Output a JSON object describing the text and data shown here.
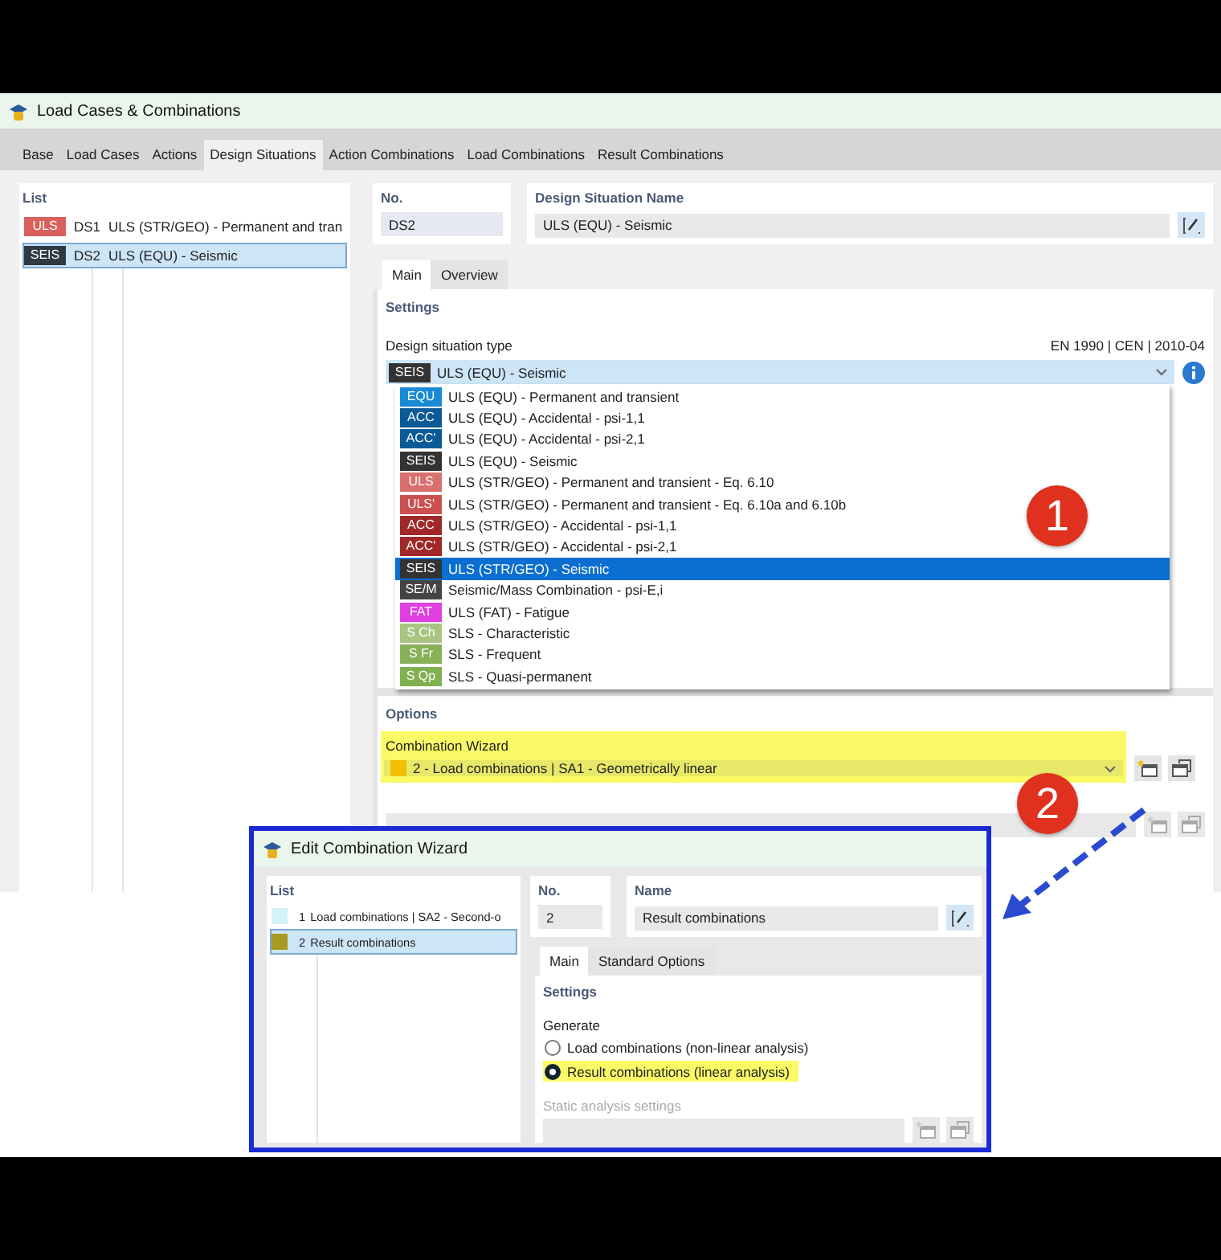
{
  "window": {
    "title": "Load Cases & Combinations"
  },
  "tabs": [
    {
      "label": "Base",
      "selected": false
    },
    {
      "label": "Load Cases",
      "selected": false
    },
    {
      "label": "Actions",
      "selected": false
    },
    {
      "label": "Design Situations",
      "selected": true
    },
    {
      "label": "Action Combinations",
      "selected": false
    },
    {
      "label": "Load Combinations",
      "selected": false
    },
    {
      "label": "Result Combinations",
      "selected": false
    }
  ],
  "list": {
    "header": "List",
    "items": [
      {
        "badge": "ULS",
        "color": "#d9605c",
        "number": "DS1",
        "name": "ULS (STR/GEO) - Permanent and tran",
        "selected": false
      },
      {
        "badge": "SEIS",
        "color": "#2f3a44",
        "number": "DS2",
        "name": "ULS (EQU) - Seismic",
        "selected": true
      }
    ]
  },
  "number": {
    "label": "No.",
    "value": "DS2"
  },
  "name": {
    "label": "Design Situation Name",
    "value": "ULS (EQU) - Seismic"
  },
  "subtabs": [
    {
      "label": "Main",
      "selected": true
    },
    {
      "label": "Overview",
      "selected": false
    }
  ],
  "settings": {
    "title": "Settings",
    "type_label": "Design situation type",
    "standard": "EN 1990 | CEN | 2010-04",
    "value": {
      "badge": "SEIS",
      "color": "#333333",
      "label": "ULS (EQU) - Seismic"
    },
    "options": [
      {
        "badge": "EQU",
        "color": "#1a8ad4",
        "label": "ULS (EQU) - Permanent and transient",
        "selected": false
      },
      {
        "badge": "ACC",
        "color": "#0b5a98",
        "label": "ULS (EQU) - Accidental - psi-1,1",
        "selected": false
      },
      {
        "badge": "ACC'",
        "color": "#0b5a98",
        "label": "ULS (EQU) - Accidental - psi-2,1",
        "selected": false
      },
      {
        "badge": "SEIS",
        "color": "#333333",
        "label": "ULS (EQU) - Seismic",
        "selected": false
      },
      {
        "badge": "ULS",
        "color": "#d97070",
        "label": "ULS (STR/GEO) - Permanent and transient - Eq. 6.10",
        "selected": false
      },
      {
        "badge": "ULS'",
        "color": "#cc5050",
        "label": "ULS (STR/GEO) - Permanent and transient - Eq. 6.10a and 6.10b",
        "selected": false
      },
      {
        "badge": "ACC",
        "color": "#a02828",
        "label": "ULS (STR/GEO) - Accidental - psi-1,1",
        "selected": false
      },
      {
        "badge": "ACC'",
        "color": "#a02828",
        "label": "ULS (STR/GEO) - Accidental - psi-2,1",
        "selected": false
      },
      {
        "badge": "SEIS",
        "color": "#333333",
        "label": "ULS (STR/GEO) - Seismic",
        "selected": true
      },
      {
        "badge": "SE/M",
        "color": "#444444",
        "label": "Seismic/Mass Combination - psi-E,i",
        "selected": false
      },
      {
        "badge": "FAT",
        "color": "#e040e0",
        "label": "ULS (FAT) - Fatigue",
        "selected": false
      },
      {
        "badge": "S Ch",
        "color": "#a8c480",
        "label": "SLS - Characteristic",
        "selected": false
      },
      {
        "badge": "S Fr",
        "color": "#88b058",
        "label": "SLS - Frequent",
        "selected": false
      },
      {
        "badge": "S Qp",
        "color": "#80b050",
        "label": "SLS - Quasi-permanent",
        "selected": false
      }
    ]
  },
  "options": {
    "title": "Options",
    "wizard": {
      "label": "Combination Wizard",
      "highlighted": true,
      "color": "#f0c000",
      "value": "2 - Load combinations | SA1 - Geometrically linear"
    }
  },
  "callouts": [
    "1",
    "2"
  ],
  "dialog": {
    "title": "Edit Combination Wizard",
    "list": {
      "header": "List",
      "items": [
        {
          "color": "#d4f2fa",
          "number": "1",
          "name": "Load combinations | SA2 - Second-o",
          "selected": false
        },
        {
          "color": "#a89a20",
          "number": "2",
          "name": "Result combinations",
          "selected": true
        }
      ]
    },
    "number": {
      "label": "No.",
      "value": "2"
    },
    "name": {
      "label": "Name",
      "value": "Result combinations"
    },
    "subtabs": [
      {
        "label": "Main",
        "selected": true
      },
      {
        "label": "Standard Options",
        "selected": false
      }
    ],
    "settings_title": "Settings",
    "generate_label": "Generate",
    "radios": [
      {
        "label": "Load combinations (non-linear analysis)",
        "selected": false,
        "highlighted": false
      },
      {
        "label": "Result combinations (linear analysis)",
        "selected": true,
        "highlighted": true
      }
    ],
    "static_label": "Static analysis settings"
  }
}
